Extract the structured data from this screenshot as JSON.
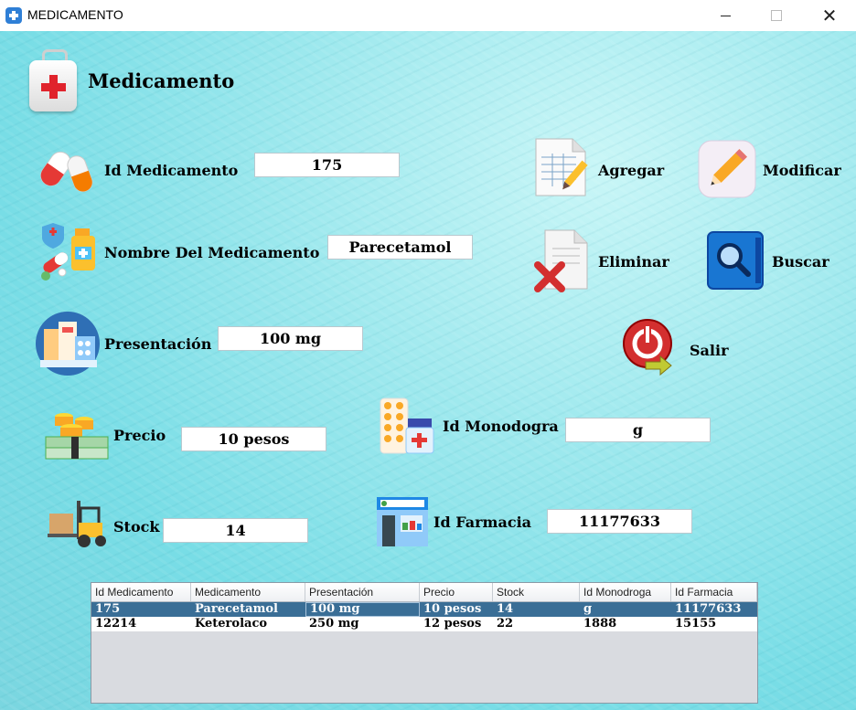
{
  "window": {
    "title": "MEDICAMENTO",
    "controls": [
      "minimize",
      "maximize",
      "close"
    ]
  },
  "header": {
    "title": "Medicamento",
    "icon": "medical-kit-icon"
  },
  "form": {
    "id_medicamento": {
      "label": "Id Medicamento",
      "value": "175",
      "icon": "pills-icon"
    },
    "nombre": {
      "label": "Nombre Del Medicamento",
      "value": "Parecetamol",
      "icon": "medicine-bottle-icon"
    },
    "presentacion": {
      "label": "Presentación",
      "value": "100 mg",
      "icon": "medicine-boxes-icon"
    },
    "precio": {
      "label": "Precio",
      "value": "10 pesos",
      "icon": "money-coins-icon"
    },
    "stock": {
      "label": "Stock",
      "value": "14",
      "icon": "forklift-icon"
    },
    "id_monodogra": {
      "label": "Id Monodogra",
      "value": "g",
      "icon": "pill-blister-icon"
    },
    "id_farmacia": {
      "label": "Id Farmacia",
      "value": "11177633",
      "icon": "pharmacy-store-icon"
    }
  },
  "actions": {
    "agregar": {
      "label": "Agregar",
      "icon": "add-document-icon"
    },
    "modificar": {
      "label": "Modificar",
      "icon": "pencil-edit-icon"
    },
    "eliminar": {
      "label": "Eliminar",
      "icon": "delete-document-icon"
    },
    "buscar": {
      "label": "Buscar",
      "icon": "search-icon"
    },
    "salir": {
      "label": "Salir",
      "icon": "power-exit-icon"
    }
  },
  "table": {
    "columns": [
      "Id Medicamento",
      "Medicamento",
      "Presentación",
      "Precio",
      "Stock",
      "Id Monodroga",
      "Id Farmacia"
    ],
    "rows": [
      [
        "175",
        "Parecetamol",
        "100 mg",
        "10 pesos",
        "14",
        "g",
        "11177633"
      ],
      [
        "12214",
        "Keterolaco",
        "250 mg",
        "12 pesos",
        "22",
        "1888",
        "15155"
      ]
    ],
    "selected_row": 0
  },
  "colors": {
    "background": "#9fe9ee",
    "selected_row": "#3a6e96",
    "cross_red": "#e0232c"
  }
}
